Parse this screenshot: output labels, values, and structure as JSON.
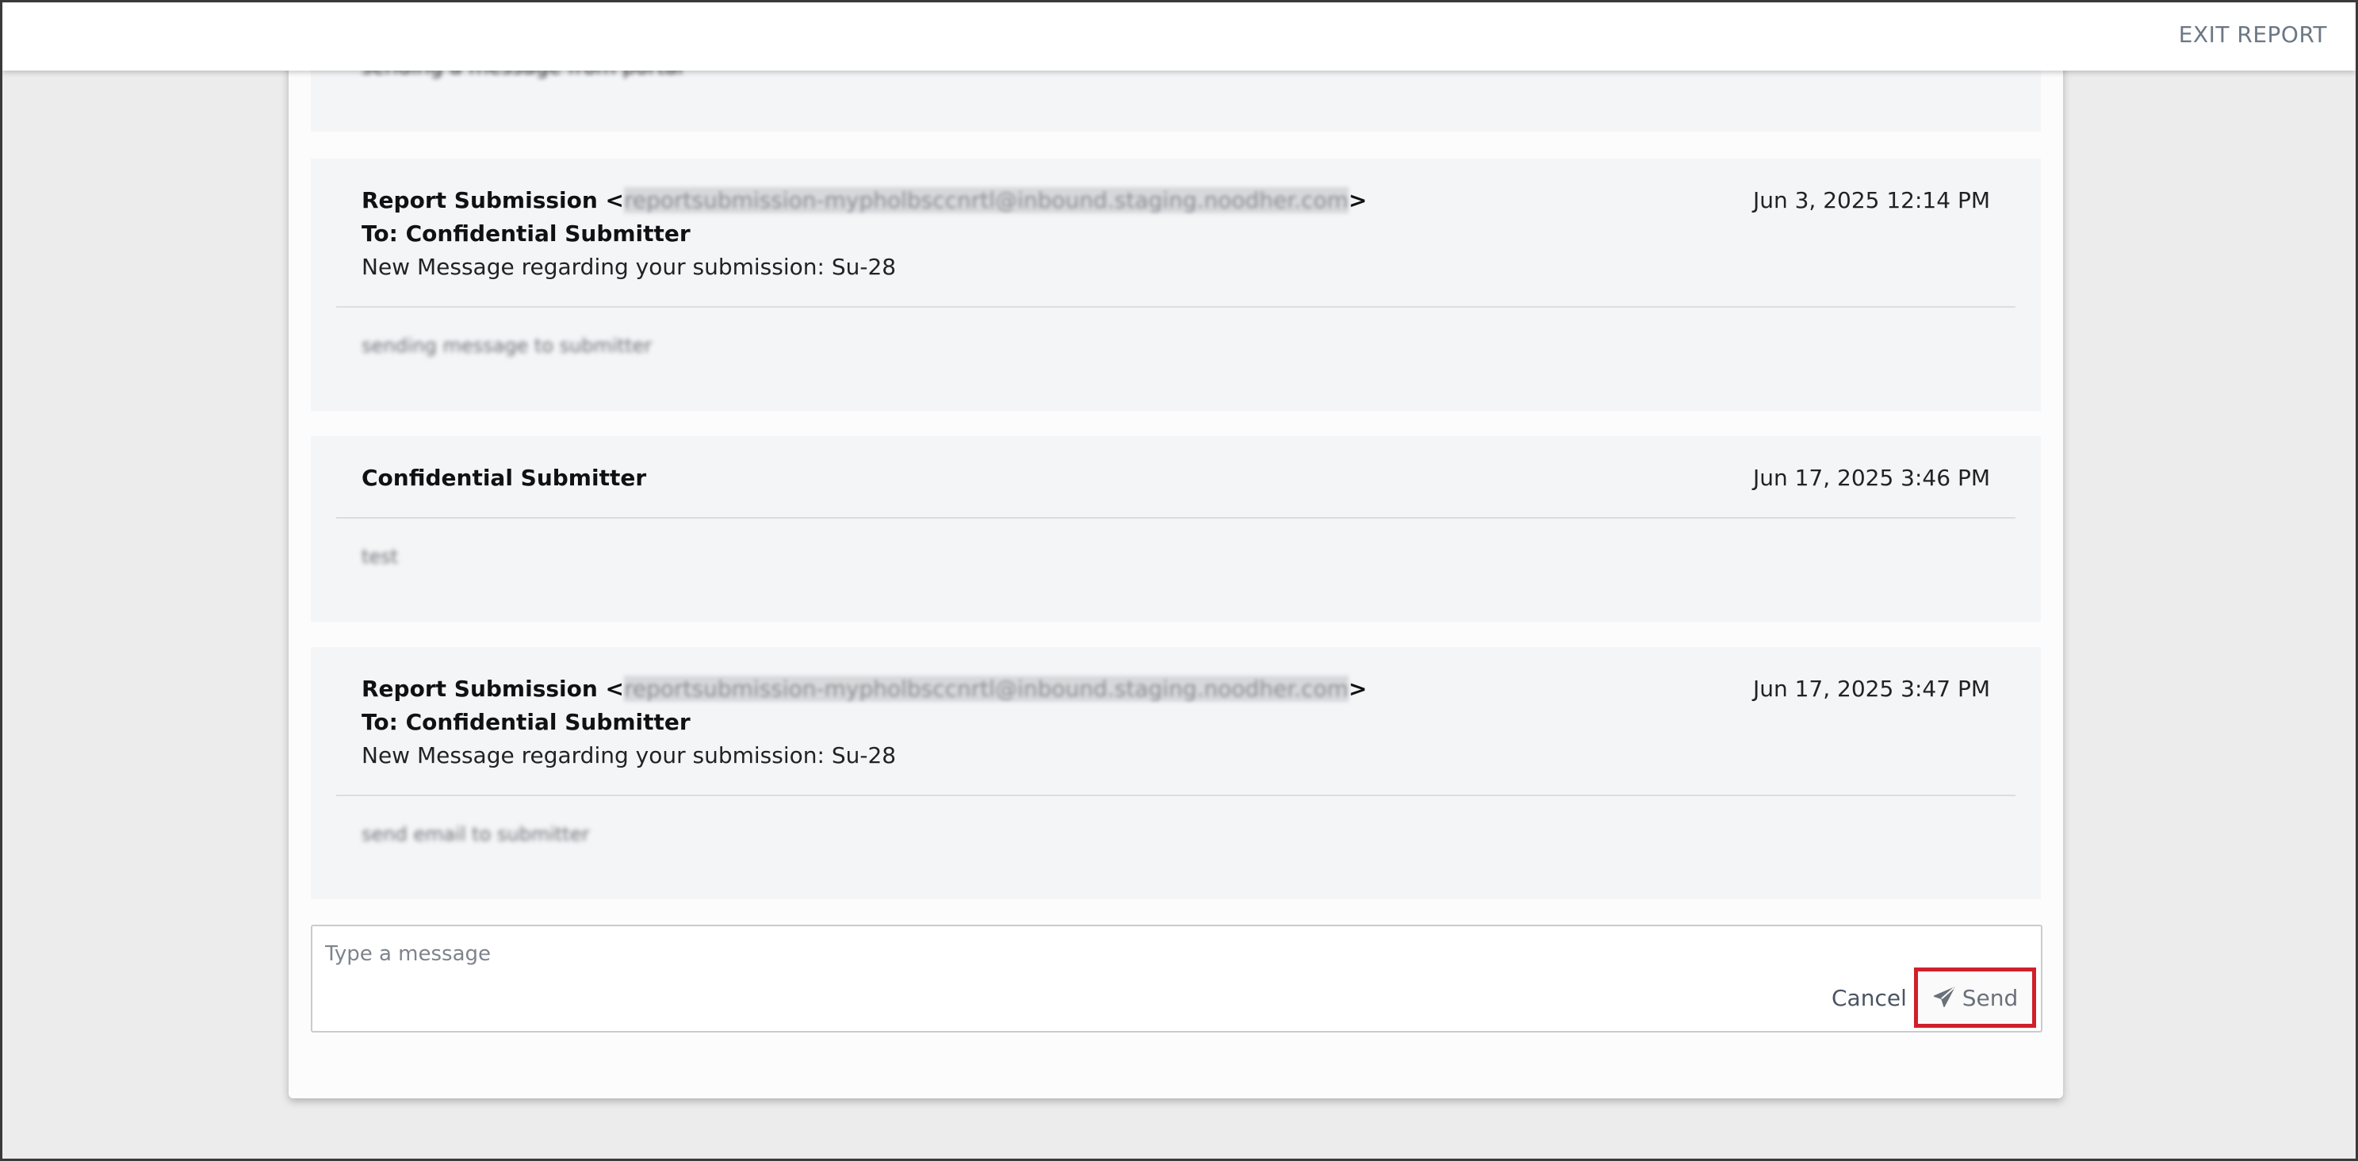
{
  "topbar": {
    "exit_label": "EXIT REPORT"
  },
  "messages": [
    {
      "partial_body": "sending a message from portal"
    },
    {
      "from_name": "Report Submission",
      "from_email": "reportsubmission-mypholbsccnrtl@inbound.staging.noodher.com",
      "date": "Jun 3, 2025 12:14 PM",
      "to": "To: Confidential Submitter",
      "subject": "New Message regarding your submission: Su-28",
      "body": "sending message to submitter"
    },
    {
      "from_name": "Confidential Submitter",
      "date": "Jun 17, 2025 3:46 PM",
      "body": "test"
    },
    {
      "from_name": "Report Submission",
      "from_email": "reportsubmission-mypholbsccnrtl@inbound.staging.noodher.com",
      "date": "Jun 17, 2025 3:47 PM",
      "to": "To: Confidential Submitter",
      "subject": "New Message regarding your submission: Su-28",
      "body": "send email to submitter"
    }
  ],
  "composer": {
    "placeholder": "Type a message",
    "cancel_label": "Cancel",
    "send_label": "Send",
    "send_icon": "paper-plane-icon",
    "highlight_color": "#d0202a"
  }
}
